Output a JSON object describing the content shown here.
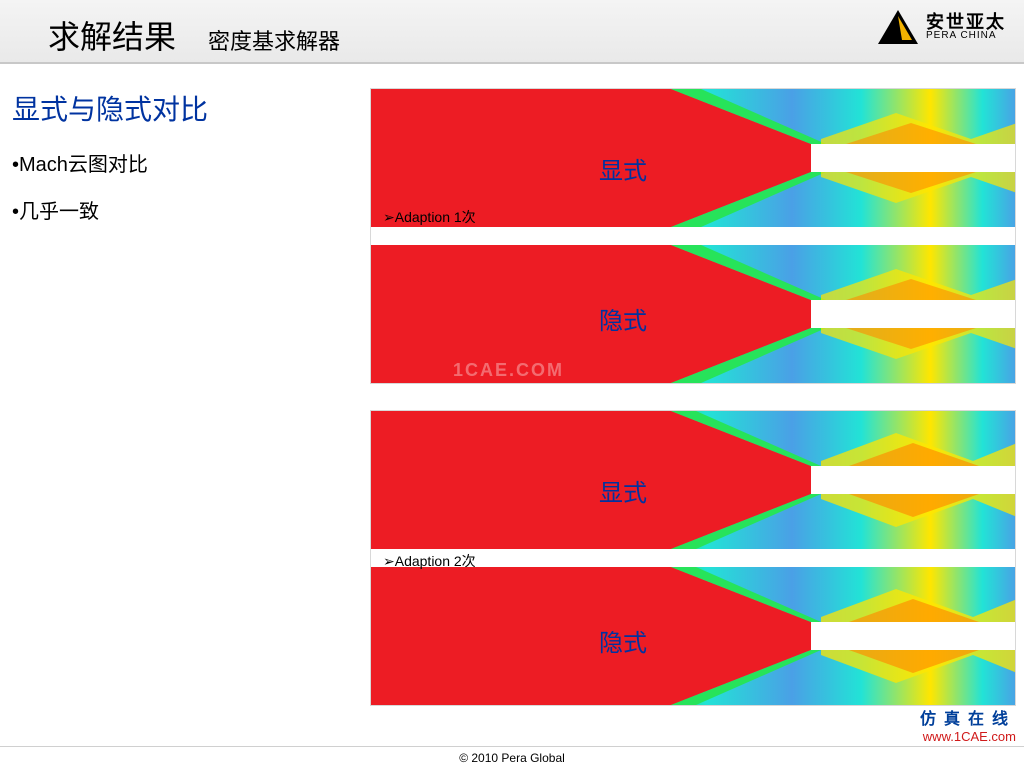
{
  "header": {
    "title": "求解结果",
    "subtitle": "密度基求解器",
    "logo_cn": "安世亚太",
    "logo_en": "PERA CHINA"
  },
  "sidebar": {
    "heading": "显式与隐式对比",
    "bullets": [
      "•Mach云图对比",
      "•几乎一致"
    ]
  },
  "panels": [
    {
      "adaption_label": "➢Adaption 1次",
      "top_label": "显式",
      "bottom_label": "隐式",
      "watermark": "1CAE.COM"
    },
    {
      "adaption_label": "➢Adaption 2次",
      "top_label": "显式",
      "bottom_label": "隐式",
      "watermark": ""
    }
  ],
  "footer": {
    "copyright": "© 2010 Pera Global"
  },
  "corner": {
    "cn": "仿真在线",
    "url": "www.1CAE.com"
  },
  "colormap": {
    "red": "#ed1c24",
    "orange": "#ff8a00",
    "yellow": "#ffe600",
    "green": "#27e35a",
    "cyan": "#22e3d6",
    "blue": "#4aa0e6"
  }
}
